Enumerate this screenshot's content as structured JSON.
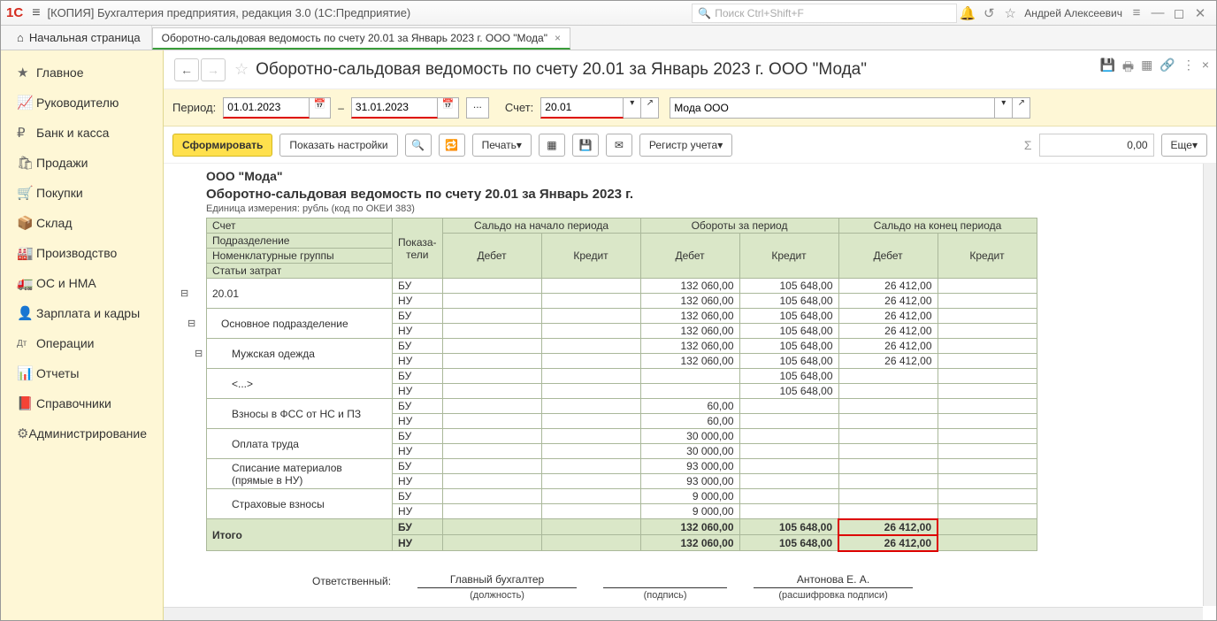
{
  "titlebar": {
    "title": "[КОПИЯ] Бухгалтерия предприятия, редакция 3.0  (1С:Предприятие)",
    "search_placeholder": "Поиск Ctrl+Shift+F",
    "user": "Андрей Алексеевич"
  },
  "tabs": {
    "home": "Начальная страница",
    "active": "Оборотно-сальдовая ведомость по счету 20.01 за Январь 2023 г. ООО \"Мода\""
  },
  "sidebar": {
    "items": [
      {
        "icon": "★",
        "label": "Главное"
      },
      {
        "icon": "📈",
        "label": "Руководителю"
      },
      {
        "icon": "₽",
        "label": "Банк и касса"
      },
      {
        "icon": "🛍",
        "label": "Продажи"
      },
      {
        "icon": "🛒",
        "label": "Покупки"
      },
      {
        "icon": "📦",
        "label": "Склад"
      },
      {
        "icon": "🏭",
        "label": "Производство"
      },
      {
        "icon": "🚛",
        "label": "ОС и НМА"
      },
      {
        "icon": "👤",
        "label": "Зарплата и кадры"
      },
      {
        "icon": "Дт",
        "label": "Операции"
      },
      {
        "icon": "📊",
        "label": "Отчеты"
      },
      {
        "icon": "📕",
        "label": "Справочники"
      },
      {
        "icon": "⚙",
        "label": "Администрирование"
      }
    ]
  },
  "header": {
    "title": "Оборотно-сальдовая ведомость по счету 20.01 за Январь 2023 г. ООО \"Мода\""
  },
  "params": {
    "period_label": "Период:",
    "date_from": "01.01.2023",
    "date_dash": "–",
    "date_to": "31.01.2023",
    "dots": "...",
    "account_label": "Счет:",
    "account": "20.01",
    "org": "Мода ООО"
  },
  "toolbar": {
    "form": "Сформировать",
    "show_settings": "Показать настройки",
    "print": "Печать",
    "register": "Регистр учета",
    "sum": "0,00",
    "more": "Еще"
  },
  "report": {
    "org": "ООО \"Мода\"",
    "title": "Оборотно-сальдовая ведомость по счету 20.01 за Январь 2023 г.",
    "unit": "Единица измерения: рубль (код по ОКЕИ 383)",
    "head": {
      "account": "Счет",
      "indicators": "Показа-\nтели",
      "open_bal": "Сальдо на начало периода",
      "turnover": "Обороты за период",
      "close_bal": "Сальдо на конец периода",
      "sub1": "Подразделение",
      "sub2": "Номенклатурные группы",
      "sub3": "Статьи затрат",
      "debit": "Дебет",
      "credit": "Кредит"
    },
    "rows": [
      {
        "name": "20.01",
        "lvl": 0,
        "bu_d": "132 060,00",
        "bu_c": "105 648,00",
        "bu_e": "26 412,00",
        "nu_d": "132 060,00",
        "nu_c": "105 648,00",
        "nu_e": "26 412,00"
      },
      {
        "name": "Основное подразделение",
        "lvl": 1,
        "bu_d": "132 060,00",
        "bu_c": "105 648,00",
        "bu_e": "26 412,00",
        "nu_d": "132 060,00",
        "nu_c": "105 648,00",
        "nu_e": "26 412,00"
      },
      {
        "name": "Мужская одежда",
        "lvl": 2,
        "bu_d": "132 060,00",
        "bu_c": "105 648,00",
        "bu_e": "26 412,00",
        "nu_d": "132 060,00",
        "nu_c": "105 648,00",
        "nu_e": "26 412,00"
      },
      {
        "name": "<...>",
        "lvl": 2,
        "bu_d": "",
        "bu_c": "105 648,00",
        "bu_e": "",
        "nu_d": "",
        "nu_c": "105 648,00",
        "nu_e": ""
      },
      {
        "name": "Взносы в ФСС от НС и ПЗ",
        "lvl": 2,
        "bu_d": "60,00",
        "bu_c": "",
        "bu_e": "",
        "nu_d": "60,00",
        "nu_c": "",
        "nu_e": ""
      },
      {
        "name": "Оплата труда",
        "lvl": 2,
        "bu_d": "30 000,00",
        "bu_c": "",
        "bu_e": "",
        "nu_d": "30 000,00",
        "nu_c": "",
        "nu_e": ""
      },
      {
        "name": "Списание материалов (прямые в НУ)",
        "lvl": 2,
        "bu_d": "93 000,00",
        "bu_c": "",
        "bu_e": "",
        "nu_d": "93 000,00",
        "nu_c": "",
        "nu_e": ""
      },
      {
        "name": "Страховые взносы",
        "lvl": 2,
        "bu_d": "9 000,00",
        "bu_c": "",
        "bu_e": "",
        "nu_d": "9 000,00",
        "nu_c": "",
        "nu_e": ""
      }
    ],
    "total_label": "Итого",
    "total": {
      "bu_d": "132 060,00",
      "bu_c": "105 648,00",
      "bu_e": "26 412,00",
      "nu_d": "132 060,00",
      "nu_c": "105 648,00",
      "nu_e": "26 412,00"
    },
    "sig": {
      "responsible": "Ответственный:",
      "position_val": "Главный бухгалтер",
      "position": "(должность)",
      "sign": "(подпись)",
      "name_val": "Антонова Е. А.",
      "name": "(расшифровка подписи)"
    }
  }
}
